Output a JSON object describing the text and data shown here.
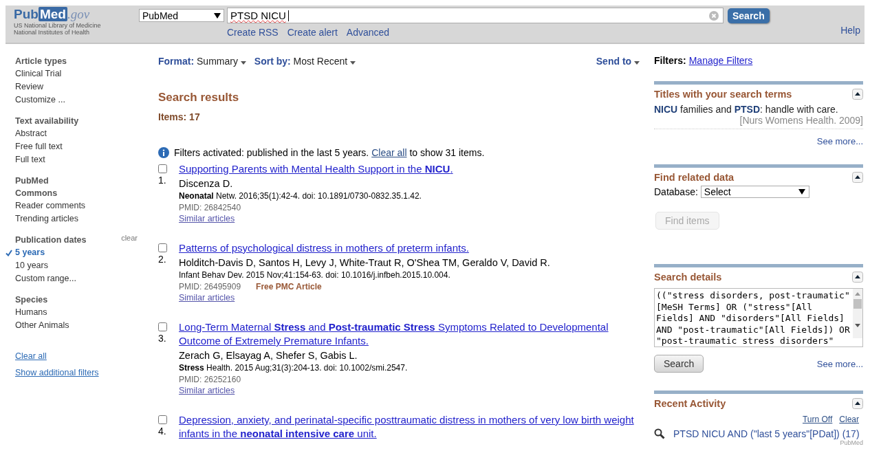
{
  "header": {
    "logo": {
      "pub": "Pub",
      "med": "Med",
      "gov": ".gov"
    },
    "logo_subtitle": [
      "US National Library of Medicine",
      "National Institutes of Health"
    ],
    "database": "PubMed",
    "query": "PTSD NICU",
    "search_button": "Search",
    "links": [
      "Create RSS",
      "Create alert",
      "Advanced"
    ],
    "help": "Help"
  },
  "sidebar": {
    "groups": [
      {
        "heading": "Article types",
        "items": [
          {
            "label": "Clinical Trial",
            "selected": false
          },
          {
            "label": "Review",
            "selected": false
          },
          {
            "label": "Customize ...",
            "selected": false
          }
        ]
      },
      {
        "heading": "Text availability",
        "items": [
          {
            "label": "Abstract",
            "selected": false
          },
          {
            "label": "Free full text",
            "selected": false
          },
          {
            "label": "Full text",
            "selected": false
          }
        ]
      },
      {
        "heading": "PubMed Commons",
        "items": [
          {
            "label": "Reader comments",
            "selected": false
          },
          {
            "label": "Trending articles",
            "selected": false
          }
        ]
      },
      {
        "heading": "Publication dates",
        "clear": "clear",
        "items": [
          {
            "label": "5 years",
            "selected": true
          },
          {
            "label": "10 years",
            "selected": false
          },
          {
            "label": "Custom range...",
            "selected": false
          }
        ]
      },
      {
        "heading": "Species",
        "items": [
          {
            "label": "Humans",
            "selected": false
          },
          {
            "label": "Other Animals",
            "selected": false
          }
        ]
      }
    ],
    "links": [
      "Clear all",
      "Show additional filters"
    ]
  },
  "toolbar": {
    "format_label": "Format:",
    "format": "Summary",
    "sort_label": "Sort by:",
    "sort": "Most Recent",
    "send_to": "Send to"
  },
  "results_heading": "Search results",
  "items_count": "Items: 17",
  "filter_notice": {
    "before": "Filters activated: published in the last 5 years.",
    "link": "Clear all",
    "after": "to show 31 items."
  },
  "results": [
    {
      "number": "1.",
      "checked": false,
      "title": "Supporting Parents with Mental Health Support in the **NICU**.",
      "authors": "Discenza D.",
      "citation": "**Neonatal** Netw. 2016;35(1):42-4. doi: 10.1891/0730-0832.35.1.42.",
      "pmid": "PMID: 26842540",
      "similar": "Similar articles"
    },
    {
      "number": "2.",
      "checked": false,
      "title": "Patterns of psychological distress in mothers of preterm infants.",
      "authors": "Holditch-Davis D, Santos H, Levy J, White-Traut R, O'Shea TM, Geraldo V, David R.",
      "citation": "Infant Behav Dev. 2015 Nov;41:154-63. doi: 10.1016/j.infbeh.2015.10.004.",
      "pmid": "PMID: 26495909",
      "free": "Free PMC Article",
      "similar": "Similar articles"
    },
    {
      "number": "3.",
      "checked": false,
      "title": "Long-Term Maternal **Stress** and **Post-traumatic Stress** Symptoms Related to Developmental Outcome of Extremely Premature Infants.",
      "authors": "Zerach G, Elsayag A, Shefer S, Gabis L.",
      "citation": "**Stress** Health. 2015 Aug;31(3):204-13. doi: 10.1002/smi.2547.",
      "pmid": "PMID: 26252160",
      "similar": "Similar articles"
    },
    {
      "number": "4.",
      "checked": false,
      "title": "Depression, anxiety, and perinatal-specific posttraumatic distress in mothers of very low birth weight infants in the **neonatal intensive care** unit."
    }
  ],
  "filters": {
    "label": "Filters:",
    "link": "Manage Filters"
  },
  "panels": [
    {
      "kind": "titles",
      "title": "Titles with your search terms",
      "item": "**NICU** families and **PTSD**: handle with care.",
      "source": "[Nurs Womens Health. 2009]",
      "more": "See more..."
    },
    {
      "kind": "related",
      "title": "Find related data",
      "db_label": "Database:",
      "db_value": "Select",
      "button": "Find items",
      "disabled": true
    },
    {
      "kind": "details",
      "title": "Search details",
      "text": "((\"stress disorders, post-traumatic\"[MeSH Terms] OR (\"stress\"[All Fields] AND \"disorders\"[All Fields] AND \"post-traumatic\"[All Fields]) OR \"post-traumatic stress disorders\"",
      "button": "Search",
      "more": "See more..."
    },
    {
      "kind": "activity",
      "title": "Recent Activity",
      "links": [
        "Turn Off",
        "Clear"
      ],
      "entry": "PTSD NICU AND (\"last 5 years\"[PDat]) (17)",
      "db": "PubMed"
    }
  ]
}
